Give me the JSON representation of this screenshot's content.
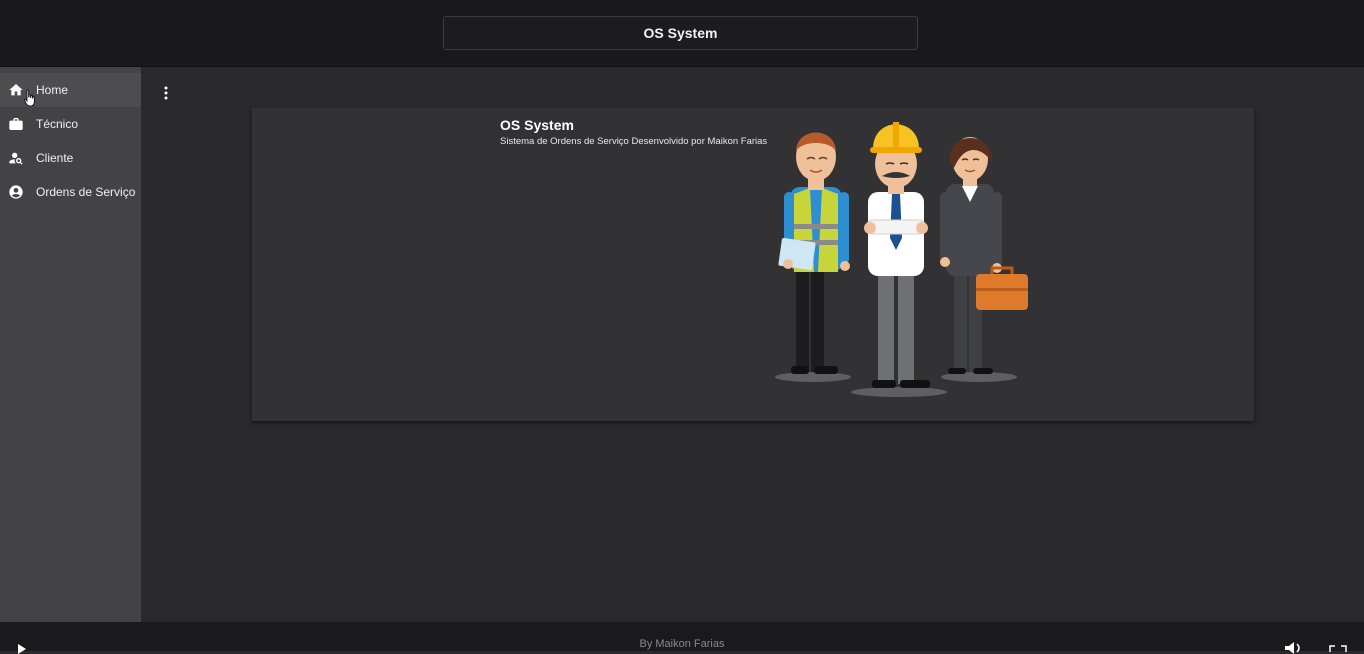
{
  "header": {
    "title": "OS System"
  },
  "sidebar": {
    "items": [
      {
        "label": "Home",
        "icon": "home-icon",
        "active": true
      },
      {
        "label": "Técnico",
        "icon": "briefcase-icon",
        "active": false
      },
      {
        "label": "Cliente",
        "icon": "person-search-icon",
        "active": false
      },
      {
        "label": "Ordens de Serviço",
        "icon": "account-circle-icon",
        "active": false
      }
    ]
  },
  "main": {
    "menu_icon": "more-vert-icon",
    "card": {
      "title": "OS System",
      "subtitle": "Sistema de Ordens de Serviço Desenvolvido por Maikon Farias",
      "illustration": "workers-illustration"
    }
  },
  "footer": {
    "text": "By Maikon Farias"
  },
  "video_controls": {
    "play_icon": "play-icon",
    "volume_icon": "volume-icon",
    "fullscreen_icon": "fullscreen-icon"
  },
  "colors": {
    "topbar": "#19181a",
    "sidebar": "#434345",
    "sidebar_active": "#4d4d4f",
    "main": "#2a2a2c",
    "card": "#323234",
    "footer": "#1a1a1c"
  }
}
